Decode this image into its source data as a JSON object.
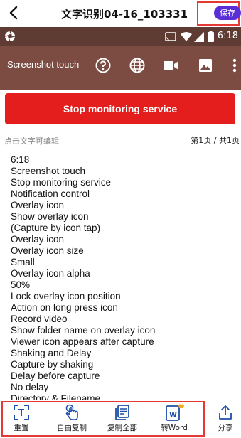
{
  "header": {
    "title": "文字识别04-16_103331",
    "save_label": "保存"
  },
  "screenshot": {
    "status_time": "6:18",
    "app_title": "Screenshot touch",
    "button_label": "Stop monitoring service"
  },
  "hint": "点击文字可编辑",
  "page_indicator": "第1页 / 共1页",
  "text_lines": [
    "6:18",
    "Screenshot touch",
    "Stop monitoring service",
    "Notification control",
    "Overlay icon",
    "Show overlay icon",
    "(Capture by icon tap)",
    "Overlay icon",
    "Overlay icon size",
    "Small",
    "Overlay icon alpha",
    "50%",
    "Lock overlay icon position",
    "Action on long press icon",
    "Record video",
    "Show folder name on overlay icon",
    "Viewer icon appears after capture",
    "Shaking and Delay",
    "Capture by shaking",
    "Delay before capture",
    "No delay",
    "Directory & Filename"
  ],
  "toolbar": {
    "reset": "重置",
    "free_copy": "自由复制",
    "copy_all": "复制全部",
    "to_word": "转Word",
    "share": "分享"
  },
  "colors": {
    "accent": "#5b2fd6",
    "highlight_border": "#e53935",
    "stop_button": "#e41d1d",
    "app_bar": "#7c4c42"
  }
}
